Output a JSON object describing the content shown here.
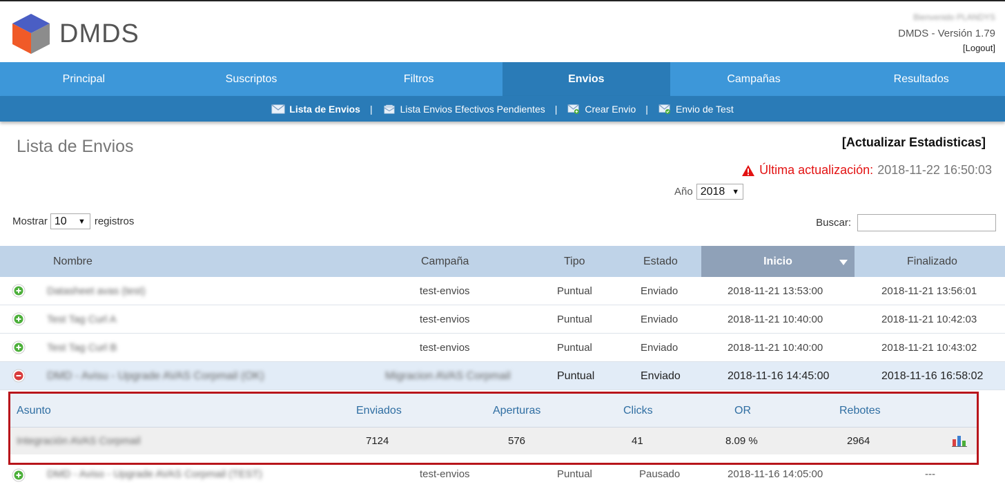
{
  "header": {
    "logo_text": "DMDS",
    "user_greeting": "Bienvenido PLANDYS",
    "version": "DMDS - Versión 1.79",
    "logout": "[Logout]"
  },
  "main_nav": {
    "tabs": [
      {
        "label": "Principal",
        "active": false
      },
      {
        "label": "Suscriptos",
        "active": false
      },
      {
        "label": "Filtros",
        "active": false
      },
      {
        "label": "Envios",
        "active": true
      },
      {
        "label": "Campañas",
        "active": false
      },
      {
        "label": "Resultados",
        "active": false
      }
    ]
  },
  "sub_nav": {
    "items": [
      {
        "label": "Lista de Envios",
        "icon": "envelope-icon",
        "active": true
      },
      {
        "label": "Lista Envios Efectivos Pendientes",
        "icon": "inbox-icon",
        "active": false
      },
      {
        "label": "Crear Envio",
        "icon": "envelope-add-icon",
        "active": false
      },
      {
        "label": "Envio de Test",
        "icon": "envelope-check-icon",
        "active": false
      }
    ],
    "separator": "|"
  },
  "page": {
    "title": "Lista de Envios",
    "update_link": "[Actualizar Estadisticas]",
    "last_update_label": "Última actualización:",
    "last_update_value": "2018-11-22 16:50:03",
    "year_label": "Año",
    "year_value": "2018",
    "show_label": "Mostrar",
    "show_value": "10",
    "show_suffix": "registros",
    "search_label": "Buscar:",
    "search_value": ""
  },
  "table": {
    "columns": [
      "Nombre",
      "Campaña",
      "Tipo",
      "Estado",
      "Inicio",
      "Finalizado"
    ],
    "sorted_column": "Inicio",
    "rows": [
      {
        "nombre": "Datasheet avas (test)",
        "campana": "test-envios",
        "tipo": "Puntual",
        "estado": "Enviado",
        "inicio": "2018-11-21 13:53:00",
        "finalizado": "2018-11-21 13:56:01"
      },
      {
        "nombre": "Test Tag Curl A",
        "campana": "test-envios",
        "tipo": "Puntual",
        "estado": "Enviado",
        "inicio": "2018-11-21 10:40:00",
        "finalizado": "2018-11-21 10:42:03"
      },
      {
        "nombre": "Test Tag Curl B",
        "campana": "test-envios",
        "tipo": "Puntual",
        "estado": "Enviado",
        "inicio": "2018-11-21 10:40:00",
        "finalizado": "2018-11-21 10:43:02"
      },
      {
        "nombre": "DMD - Avisu - Upgrade AVAS Corpmail (OK)",
        "campana": "Migracion AVAS Corpmail",
        "tipo": "Puntual",
        "estado": "Enviado",
        "inicio": "2018-11-16 14:45:00",
        "finalizado": "2018-11-16 16:58:02"
      }
    ],
    "partial_row": {
      "nombre": "DMD - Aviso - Upgrade AVAS Corpmail (TEST)",
      "campana": "test-envios",
      "tipo": "Puntual",
      "estado": "Pausado",
      "inicio": "2018-11-16 14:05:00",
      "finalizado": "---"
    }
  },
  "detail": {
    "columns": [
      "Asunto",
      "Enviados",
      "Aperturas",
      "Clicks",
      "OR",
      "Rebotes"
    ],
    "row": {
      "asunto": "Integración AVAS Corpmail",
      "enviados": "7124",
      "aperturas": "576",
      "clicks": "41",
      "or": "8.09 %",
      "rebotes": "2964"
    },
    "chart_icon": "bar-chart-icon"
  },
  "colors": {
    "nav_blue": "#3d97d9",
    "nav_dark": "#2a7bb7",
    "header_row": "#bfd3e8",
    "sorted_header": "#8fa1b8",
    "highlight_border": "#b8151b",
    "warning_red": "#e31212",
    "plus_green": "#4caf3a",
    "minus_red": "#d83b3b"
  }
}
